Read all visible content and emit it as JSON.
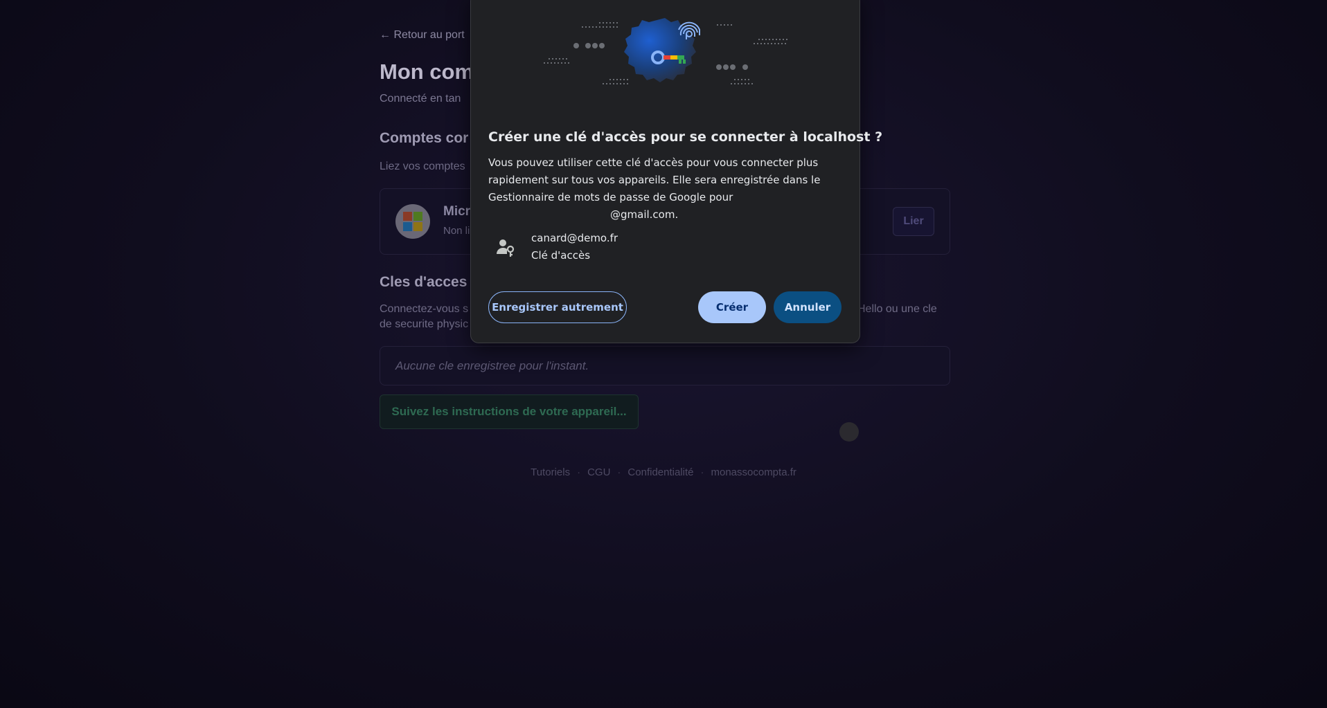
{
  "page": {
    "back_link": "← Retour au port",
    "title": "Mon com",
    "subtitle": "Connecté en tan",
    "linked_accounts": {
      "title": "Comptes cor",
      "description": "Liez vos comptes",
      "microsoft": {
        "name": "Micr",
        "status": "Non li",
        "link_button": "Lier"
      }
    },
    "passkeys": {
      "title": "Cles d'acces",
      "description_left": "Connectez-vous s",
      "description_left_2": "de securite physic",
      "description_right": "Hello ou une cle",
      "empty": "Aucune cle enregistree pour l'instant.",
      "follow_button": "Suivez les instructions de votre appareil..."
    },
    "footer": {
      "links": [
        "Tutoriels",
        "CGU",
        "Confidentialité",
        "monassocompta.fr"
      ],
      "separator": "·"
    }
  },
  "dialog": {
    "title": "Créer une clé d'accès pour se connecter à localhost ?",
    "body_line1": "Vous pouvez utiliser cette clé d'accès pour vous connecter plus",
    "body_line2": "rapidement sur tous vos appareils. Elle sera enregistrée dans le",
    "body_line3": "Gestionnaire de mots de passe de Google pour",
    "body_email": "@gmail.com.",
    "account_email": "canard@demo.fr",
    "account_type": "Clé d'accès",
    "buttons": {
      "other": "Enregistrer autrement",
      "create": "Créer",
      "cancel": "Annuler"
    }
  },
  "colors": {
    "dialog_bg": "#202124",
    "primary_button": "#a8c7fa",
    "cancel_button": "#0b4f82",
    "outline_button": "#8ab4f8"
  }
}
